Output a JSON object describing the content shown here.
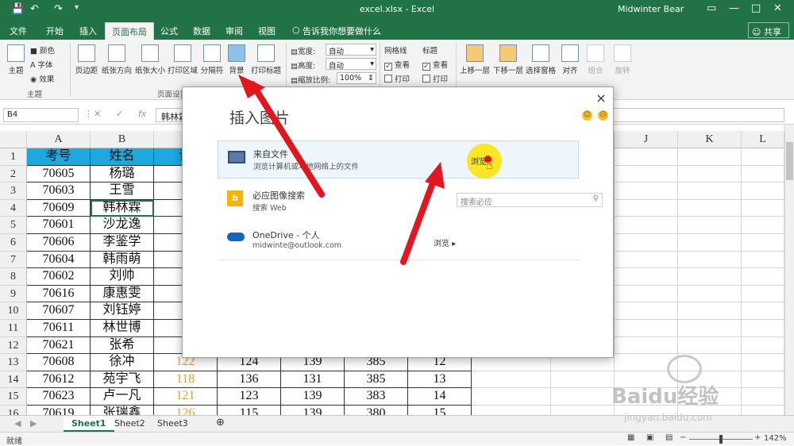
{
  "titlebar": {
    "save_icon": "save-icon",
    "undo_icon": "undo-icon",
    "title": "excel.xlsx - Excel",
    "user": "Midwinter Bear"
  },
  "tabs": [
    {
      "label": "文件"
    },
    {
      "label": "开始"
    },
    {
      "label": "插入"
    },
    {
      "label": "页面布局",
      "active": true
    },
    {
      "label": "公式"
    },
    {
      "label": "数据"
    },
    {
      "label": "审阅"
    },
    {
      "label": "视图"
    },
    {
      "label": "告诉我你想要做什么"
    }
  ],
  "share": "共享",
  "ribbon": {
    "theme": {
      "btn": "主题",
      "colors": "颜色",
      "fonts": "字体",
      "effects": "效果",
      "group": "主题"
    },
    "page_setup": {
      "margins": "页边距",
      "orientation": "纸张方向",
      "size": "纸张大小",
      "print_area": "打印区域",
      "breaks": "分隔符",
      "background": "背景",
      "print_titles": "打印标题",
      "group": "页面设置"
    },
    "scale": {
      "width_label": "宽度:",
      "width_value": "自动",
      "height_label": "高度:",
      "height_value": "自动",
      "scale_label": "缩放比例:",
      "scale_value": "100%"
    },
    "gridlines": {
      "title": "网格线",
      "view": "查看",
      "print": "打印"
    },
    "headings": {
      "title": "标题",
      "view": "查看",
      "print": "打印"
    },
    "arrange": {
      "forward": "上移一层",
      "backward": "下移一层",
      "pane": "选择窗格",
      "align": "对齐",
      "group": "组合",
      "rotate": "旋转"
    }
  },
  "formula": {
    "namebox": "B4",
    "fx": "fx",
    "value": "韩林霖"
  },
  "columns": [
    "A",
    "B",
    "C",
    "D",
    "E",
    "F",
    "G",
    "H",
    "I",
    "J",
    "K",
    "L"
  ],
  "rows": [
    [
      "考号",
      "姓名",
      "语",
      "",
      "",
      "",
      "",
      ""
    ],
    [
      "70605",
      "杨璐",
      "1",
      "",
      "",
      "",
      "",
      ""
    ],
    [
      "70603",
      "王雪",
      "1",
      "",
      "",
      "",
      "",
      ""
    ],
    [
      "70609",
      "韩林霖",
      "1",
      "",
      "",
      "",
      "",
      ""
    ],
    [
      "70601",
      "沙龙逸",
      "1",
      "",
      "",
      "",
      "",
      ""
    ],
    [
      "70606",
      "李鉴学",
      "1",
      "",
      "",
      "",
      "",
      ""
    ],
    [
      "70604",
      "韩雨萌",
      "1",
      "",
      "",
      "",
      "",
      ""
    ],
    [
      "70602",
      "刘帅",
      "1",
      "",
      "",
      "",
      "",
      ""
    ],
    [
      "70616",
      "康惠雯",
      "1",
      "",
      "",
      "",
      "",
      ""
    ],
    [
      "70607",
      "刘钰婷",
      "1",
      "",
      "",
      "",
      "",
      ""
    ],
    [
      "70611",
      "林世博",
      "1",
      "",
      "",
      "",
      "",
      ""
    ],
    [
      "70621",
      "张希",
      "1",
      "",
      "",
      "",
      "",
      ""
    ],
    [
      "70608",
      "徐冲",
      "122",
      "124",
      "139",
      "385",
      "12",
      ""
    ],
    [
      "70612",
      "苑宇飞",
      "118",
      "136",
      "131",
      "385",
      "13",
      ""
    ],
    [
      "70623",
      "卢一凡",
      "121",
      "123",
      "139",
      "383",
      "14",
      ""
    ],
    [
      "70619",
      "张瑞鑫",
      "126",
      "115",
      "139",
      "380",
      "15",
      ""
    ]
  ],
  "row_numbers": [
    "1",
    "2",
    "3",
    "4",
    "5",
    "6",
    "7",
    "8",
    "9",
    "10",
    "11",
    "12",
    "13",
    "14",
    "15",
    "16"
  ],
  "sheets": [
    "Sheet1",
    "Sheet2",
    "Sheet3"
  ],
  "status": {
    "mode": "就绪",
    "zoom": "142%"
  },
  "dialog": {
    "title": "插入图片",
    "close": "×",
    "options": [
      {
        "title": "来自文件",
        "subtitle": "浏览计算机或本地网络上的文件",
        "link": "浏览"
      },
      {
        "title": "必应图像搜索",
        "subtitle": "搜索 Web",
        "search_placeholder": "搜索必应"
      },
      {
        "title": "OneDrive - 个人",
        "subtitle": "midwinte@outlook.com",
        "link": "浏览"
      }
    ]
  },
  "watermark": {
    "brand": "Baidu经验",
    "url": "jingyan.baidu.com"
  },
  "colors": {
    "excel_green": "#217346",
    "header_fill": "#1ea8e0",
    "arrow_red": "#e2161d",
    "highlight": "#f9e51a",
    "orange_text": "#e3a21a"
  }
}
